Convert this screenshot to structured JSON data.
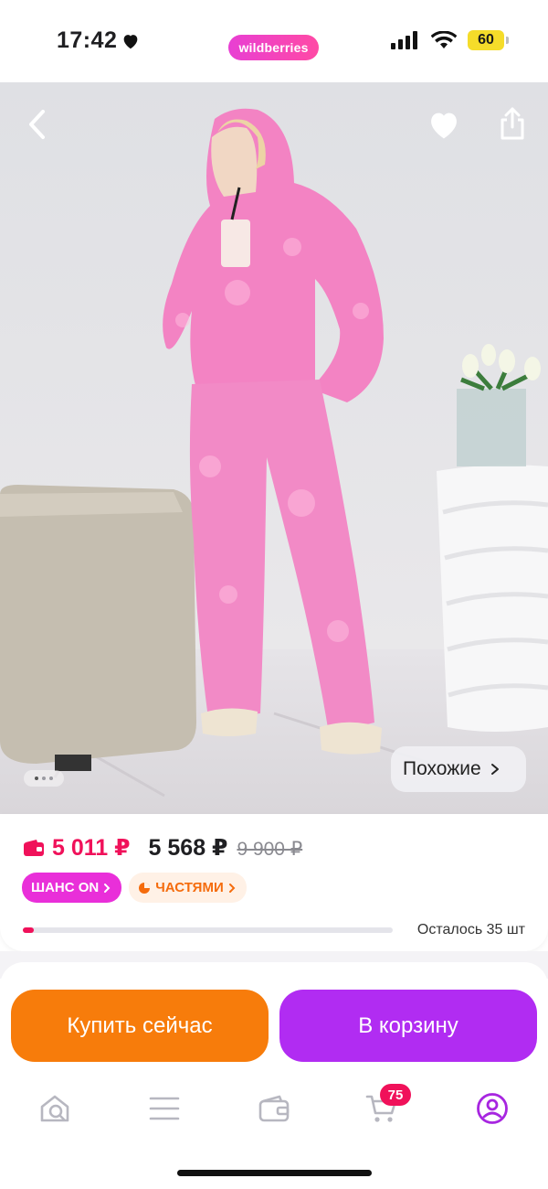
{
  "status_bar": {
    "time": "17:42",
    "brand": "wildberries",
    "battery": "60"
  },
  "product": {
    "image_alt": "Розовый спортивный костюм",
    "similar_label": "Похожие"
  },
  "pricing": {
    "wallet_price": "5 011 ₽",
    "price": "5 568 ₽",
    "old_price": "9 900 ₽",
    "badges": [
      "ШАНС ON",
      "ЧАСТЯМИ"
    ],
    "stock_label": "Осталось 35 шт",
    "stock_fill_fraction": 0.03
  },
  "actions": {
    "buy_now": "Купить сейчас",
    "to_cart": "В корзину"
  },
  "bottom_nav": {
    "items": [
      "home-icon",
      "catalog-icon",
      "wallet-icon",
      "cart-icon",
      "profile-icon"
    ],
    "cart_count": "75"
  },
  "colors": {
    "wallet_price": "#f0115a",
    "chance_badge": "#e92fd9",
    "parts_badge_text": "#f56c0d",
    "buy_button": "#f77c0b",
    "cart_button": "#b12cf2",
    "active_nav": "#a726e0"
  }
}
